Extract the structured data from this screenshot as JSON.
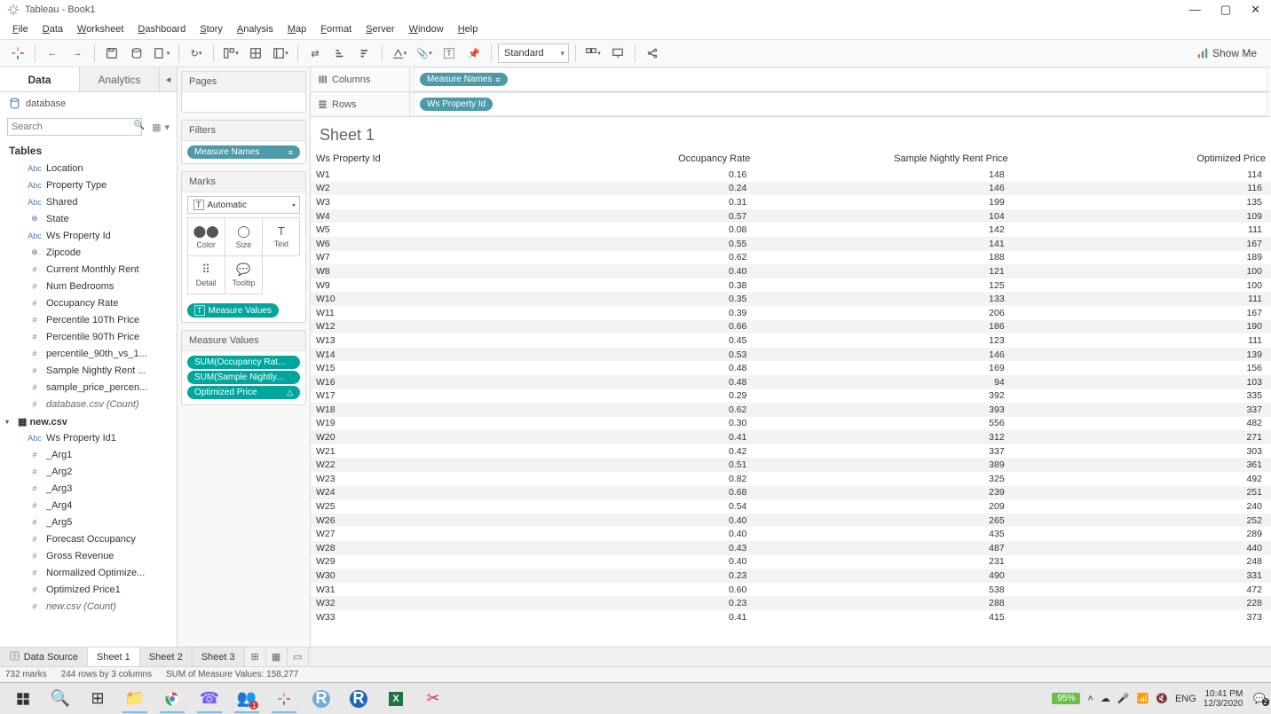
{
  "title": "Tableau - Book1",
  "menus": [
    "File",
    "Data",
    "Worksheet",
    "Dashboard",
    "Story",
    "Analysis",
    "Map",
    "Format",
    "Server",
    "Window",
    "Help"
  ],
  "toolbar": {
    "fit": "Standard",
    "showme": "Show Me"
  },
  "sidebar": {
    "tabs": {
      "data": "Data",
      "analytics": "Analytics"
    },
    "db": "database",
    "search_placeholder": "Search",
    "tables_header": "Tables",
    "fields_dim": [
      {
        "t": "abc",
        "n": "Location"
      },
      {
        "t": "abc",
        "n": "Property Type"
      },
      {
        "t": "abc",
        "n": "Shared"
      },
      {
        "t": "globe",
        "n": "State"
      },
      {
        "t": "abc",
        "n": "Ws Property Id"
      },
      {
        "t": "globe",
        "n": "Zipcode"
      }
    ],
    "fields_meas": [
      {
        "t": "hash",
        "n": "Current Monthly Rent"
      },
      {
        "t": "hash",
        "n": "Num Bedrooms"
      },
      {
        "t": "hash",
        "n": "Occupancy Rate"
      },
      {
        "t": "hash",
        "n": "Percentile 10Th Price"
      },
      {
        "t": "hash",
        "n": "Percentile 90Th Price"
      },
      {
        "t": "hash",
        "n": "percentile_90th_vs_1..."
      },
      {
        "t": "hash",
        "n": "Sample Nightly Rent ..."
      },
      {
        "t": "hash",
        "n": "sample_price_percen..."
      },
      {
        "t": "hash",
        "n": "database.csv (Count)",
        "i": true
      }
    ],
    "table2": "new.csv",
    "fields2_dim": [
      {
        "t": "abc",
        "n": "Ws Property Id1"
      }
    ],
    "fields2_meas": [
      {
        "t": "hash",
        "n": "_Arg1"
      },
      {
        "t": "hash",
        "n": "_Arg2"
      },
      {
        "t": "hash",
        "n": "_Arg3"
      },
      {
        "t": "hash",
        "n": "_Arg4"
      },
      {
        "t": "hash",
        "n": "_Arg5"
      },
      {
        "t": "hash",
        "n": "Forecast Occupancy"
      },
      {
        "t": "hash",
        "n": "Gross Revenue"
      },
      {
        "t": "hash",
        "n": "Normalized Optimize..."
      },
      {
        "t": "hash",
        "n": "Optimized Price1"
      },
      {
        "t": "hash",
        "n": "new.csv (Count)",
        "i": true
      }
    ]
  },
  "shelves": {
    "pages": "Pages",
    "filters": "Filters",
    "filter_pill": "Measure Names",
    "marks": "Marks",
    "marktype": "Automatic",
    "markbtns": [
      "Color",
      "Size",
      "Text",
      "Detail",
      "Tooltip"
    ],
    "measure_values_pill": "Measure Values",
    "mv_header": "Measure Values",
    "mv_pills": [
      "SUM(Occupancy Rat...",
      "SUM(Sample Nightly...",
      "Optimized Price"
    ]
  },
  "columns": {
    "label": "Columns",
    "pill": "Measure Names"
  },
  "rows": {
    "label": "Rows",
    "pill": "Ws Property Id"
  },
  "sheet": {
    "title": "Sheet 1",
    "headers": [
      "Ws Property Id",
      "Occupancy Rate",
      "Sample Nightly Rent Price",
      "Optimized Price"
    ],
    "rows": [
      [
        "W1",
        "0.16",
        "148",
        "114"
      ],
      [
        "W2",
        "0.24",
        "146",
        "116"
      ],
      [
        "W3",
        "0.31",
        "199",
        "135"
      ],
      [
        "W4",
        "0.57",
        "104",
        "109"
      ],
      [
        "W5",
        "0.08",
        "142",
        "111"
      ],
      [
        "W6",
        "0.55",
        "141",
        "167"
      ],
      [
        "W7",
        "0.62",
        "188",
        "189"
      ],
      [
        "W8",
        "0.40",
        "121",
        "100"
      ],
      [
        "W9",
        "0.38",
        "125",
        "100"
      ],
      [
        "W10",
        "0.35",
        "133",
        "111"
      ],
      [
        "W11",
        "0.39",
        "206",
        "167"
      ],
      [
        "W12",
        "0.66",
        "186",
        "190"
      ],
      [
        "W13",
        "0.45",
        "123",
        "111"
      ],
      [
        "W14",
        "0.53",
        "146",
        "139"
      ],
      [
        "W15",
        "0.48",
        "169",
        "156"
      ],
      [
        "W16",
        "0.48",
        "94",
        "103"
      ],
      [
        "W17",
        "0.29",
        "392",
        "335"
      ],
      [
        "W18",
        "0.62",
        "393",
        "337"
      ],
      [
        "W19",
        "0.30",
        "556",
        "482"
      ],
      [
        "W20",
        "0.41",
        "312",
        "271"
      ],
      [
        "W21",
        "0.42",
        "337",
        "303"
      ],
      [
        "W22",
        "0.51",
        "389",
        "361"
      ],
      [
        "W23",
        "0.82",
        "325",
        "492"
      ],
      [
        "W24",
        "0.68",
        "239",
        "251"
      ],
      [
        "W25",
        "0.54",
        "209",
        "240"
      ],
      [
        "W26",
        "0.40",
        "265",
        "252"
      ],
      [
        "W27",
        "0.40",
        "435",
        "289"
      ],
      [
        "W28",
        "0.43",
        "487",
        "440"
      ],
      [
        "W29",
        "0.40",
        "231",
        "248"
      ],
      [
        "W30",
        "0.23",
        "490",
        "331"
      ],
      [
        "W31",
        "0.60",
        "538",
        "472"
      ],
      [
        "W32",
        "0.23",
        "288",
        "228"
      ],
      [
        "W33",
        "0.41",
        "415",
        "373"
      ]
    ]
  },
  "sheettabs": {
    "ds": "Data Source",
    "tabs": [
      "Sheet 1",
      "Sheet 2",
      "Sheet 3"
    ]
  },
  "status": {
    "marks": "732 marks",
    "rows": "244 rows by 3 columns",
    "sum": "SUM of Measure Values: 158,277"
  },
  "taskbar": {
    "battery": "95%",
    "lang": "ENG",
    "time": "10:41 PM",
    "date": "12/3/2020"
  }
}
